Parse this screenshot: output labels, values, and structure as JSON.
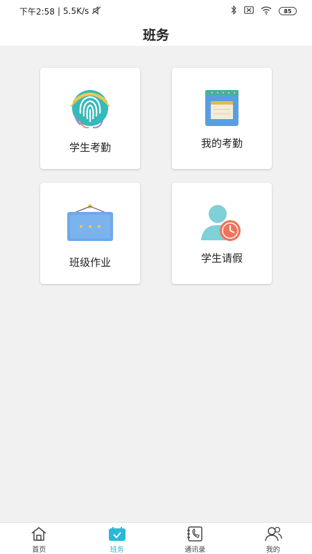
{
  "status_bar": {
    "time": "下午2:58",
    "network_speed": "5.5K/s",
    "battery": "85"
  },
  "header": {
    "title": "班务"
  },
  "cards": [
    {
      "label": "学生考勤",
      "icon": "fingerprint-icon"
    },
    {
      "label": "我的考勤",
      "icon": "calendar-board-icon"
    },
    {
      "label": "班级作业",
      "icon": "hanging-board-icon"
    },
    {
      "label": "学生请假",
      "icon": "user-clock-icon"
    }
  ],
  "tabs": [
    {
      "label": "首页",
      "icon": "home-icon",
      "active": false
    },
    {
      "label": "班务",
      "icon": "calendar-check-icon",
      "active": true
    },
    {
      "label": "通讯录",
      "icon": "phone-book-icon",
      "active": false
    },
    {
      "label": "我的",
      "icon": "users-icon",
      "active": false
    }
  ],
  "colors": {
    "accent": "#29b8d8",
    "background": "#f1f1f1",
    "card": "#ffffff"
  }
}
